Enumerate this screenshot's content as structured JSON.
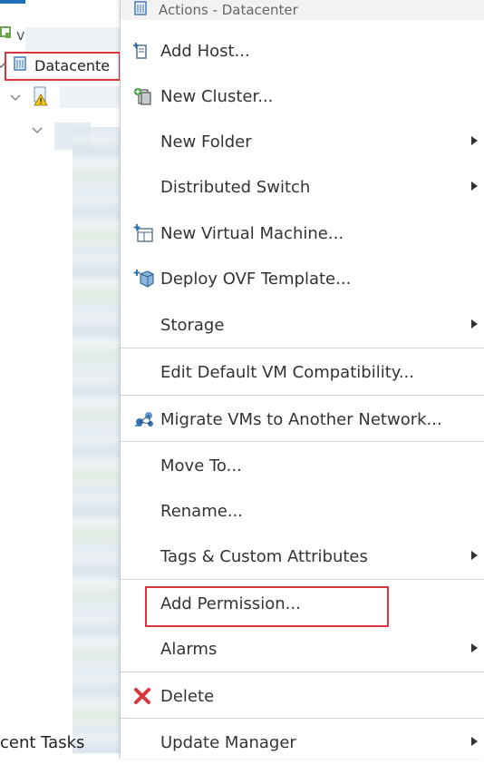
{
  "tree": {
    "root_label": "v",
    "datacenter_label": "Datacente",
    "recent_tasks_label": "cent Tasks"
  },
  "menu": {
    "header": "Actions - Datacenter",
    "items": [
      {
        "label": "Add Host...",
        "icon": "add-host-icon",
        "submenu": false
      },
      {
        "label": "New Cluster...",
        "icon": "new-cluster-icon",
        "submenu": false
      },
      {
        "label": "New Folder",
        "icon": "",
        "submenu": true
      },
      {
        "label": "Distributed Switch",
        "icon": "",
        "submenu": true
      },
      {
        "label": "New Virtual Machine...",
        "icon": "new-vm-icon",
        "submenu": false
      },
      {
        "label": "Deploy OVF Template...",
        "icon": "deploy-ovf-icon",
        "submenu": false
      },
      {
        "label": "Storage",
        "icon": "",
        "submenu": true
      },
      {
        "label": "Edit Default VM Compatibility...",
        "icon": "",
        "submenu": false
      },
      {
        "label": "Migrate VMs to Another Network...",
        "icon": "migrate-network-icon",
        "submenu": false
      },
      {
        "label": "Move To...",
        "icon": "",
        "submenu": false
      },
      {
        "label": "Rename...",
        "icon": "",
        "submenu": false
      },
      {
        "label": "Tags & Custom Attributes",
        "icon": "",
        "submenu": true
      },
      {
        "label": "Add Permission...",
        "icon": "",
        "submenu": false
      },
      {
        "label": "Alarms",
        "icon": "",
        "submenu": true
      },
      {
        "label": "Delete",
        "icon": "delete-icon",
        "submenu": false
      },
      {
        "label": "Update Manager",
        "icon": "",
        "submenu": true
      }
    ]
  },
  "colors": {
    "highlight_border": "#d9363e",
    "accent_blue": "#1d6fb8",
    "header_bg": "#f2f2f2"
  }
}
